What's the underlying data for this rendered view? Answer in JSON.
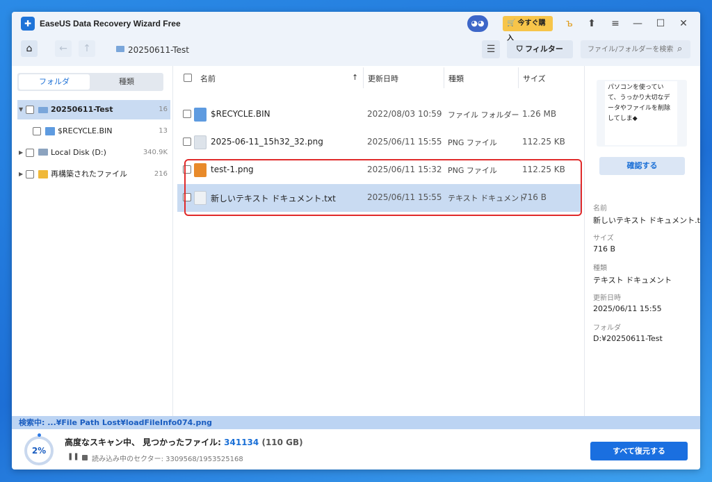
{
  "window": {
    "title": "EaseUS Data Recovery Wizard Free",
    "buy_label": "今すぐ購入",
    "titlebar_icons": [
      "gift-icon",
      "feedback-icon",
      "menu-icon",
      "minimize-icon",
      "maximize-icon",
      "close-icon"
    ]
  },
  "nav": {
    "breadcrumb": "20250611-Test",
    "filter_label": "フィルター",
    "search_placeholder": "ファイル/フォルダーを検索"
  },
  "sidebar": {
    "tabs": [
      "フォルダ",
      "種類"
    ],
    "active_tab": "フォルダ",
    "tree": [
      {
        "label": "20250611-Test",
        "count": "16"
      },
      {
        "label": "$RECYCLE.BIN",
        "count": "13"
      },
      {
        "label": "Local Disk (D:)",
        "count": "340.9K"
      },
      {
        "label": "再構築されたファイル",
        "count": "216"
      }
    ]
  },
  "list": {
    "columns": {
      "name": "名前",
      "date": "更新日時",
      "type": "種類",
      "size": "サイズ"
    },
    "sort_indicator": "↑",
    "rows": [
      {
        "name": "$RECYCLE.BIN",
        "date": "2022/08/03 10:59",
        "type": "ファイル フォルダー",
        "size": "1.26 MB"
      },
      {
        "name": "2025-06-11_15h32_32.png",
        "date": "2025/06/11 15:55",
        "type": "PNG ファイル",
        "size": "112.25 KB"
      },
      {
        "name": "test-1.png",
        "date": "2025/06/11 15:32",
        "type": "PNG ファイル",
        "size": "112.25 KB"
      },
      {
        "name": "新しいテキスト ドキュメント.txt",
        "date": "2025/06/11 15:55",
        "type": "テキスト ドキュメント",
        "size": "716 B"
      }
    ],
    "selected_row": 3
  },
  "details": {
    "preview_text": "パソコンを使っていて、うっかり大切なデータやファイルを削除してしま◆",
    "confirm_label": "確認する",
    "name_label": "名前",
    "name_value": "新しいテキスト ドキュメント.txt",
    "size_label": "サイズ",
    "size_value": "716 B",
    "type_label": "種類",
    "type_value": "テキスト ドキュメント",
    "date_label": "更新日時",
    "date_value": "2025/06/11 15:55",
    "folder_label": "フォルダ",
    "folder_value": "D:¥20250611-Test"
  },
  "status": {
    "searching": "検索中: ...¥File Path Lost¥loadFileInfo074.png",
    "progress": "2%",
    "scan_label": "高度なスキャン中、 見つかったファイル: ",
    "found_count": "341134",
    "found_size": "(110 GB)",
    "sector_text": "読み込み中のセクター: 3309568/1953525168",
    "restore_all_label": "すべて復元する"
  },
  "colors": {
    "accent": "#1a6fe0",
    "selection": "#c9dbf2",
    "highlight_box": "#e02a2a",
    "buy": "#f7c54a"
  }
}
